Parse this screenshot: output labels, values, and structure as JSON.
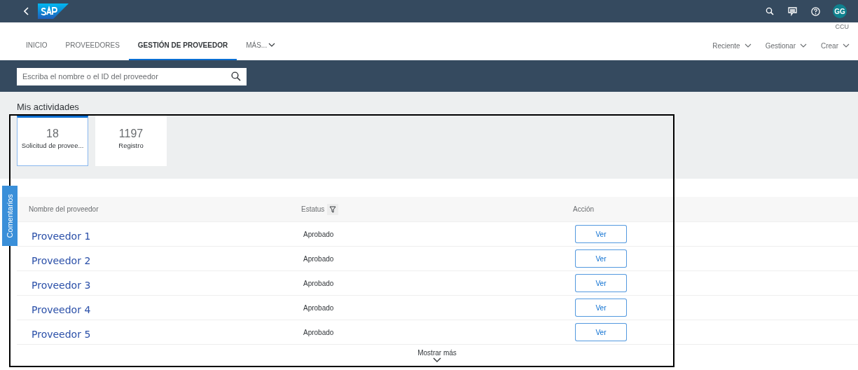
{
  "shell": {
    "user_initials": "GG",
    "user_label": "CCU"
  },
  "tabs": [
    {
      "label": "INICIO",
      "selected": false
    },
    {
      "label": "PROVEEDORES",
      "selected": false
    },
    {
      "label": "GESTIÓN DE PROVEEDOR",
      "selected": true
    },
    {
      "label": "MÁS...",
      "selected": false,
      "kind": "dropdown"
    }
  ],
  "menus": [
    "Reciente",
    "Gestionar",
    "Crear"
  ],
  "search": {
    "placeholder": "Escriba el nombre o el ID del proveedor"
  },
  "activities": {
    "title": "Mis actividades",
    "tiles": [
      {
        "count": "18",
        "label": "Solicitud de provee...",
        "selected": true
      },
      {
        "count": "1197",
        "label": "Registro",
        "selected": false
      }
    ]
  },
  "feedback_tab": "Comentarios",
  "table": {
    "columns": [
      "Nombre del proveedor",
      "Estatus",
      "Acción"
    ],
    "rows": [
      {
        "name": "Proveedor 1",
        "status": "Aprobado",
        "action": "Ver"
      },
      {
        "name": "Proveedor 2",
        "status": "Aprobado",
        "action": "Ver"
      },
      {
        "name": "Proveedor 3",
        "status": "Aprobado",
        "action": "Ver"
      },
      {
        "name": "Proveedor 4",
        "status": "Aprobado",
        "action": "Ver"
      },
      {
        "name": "Proveedor 5",
        "status": "Aprobado",
        "action": "Ver"
      }
    ],
    "show_more": "Mostrar más"
  }
}
